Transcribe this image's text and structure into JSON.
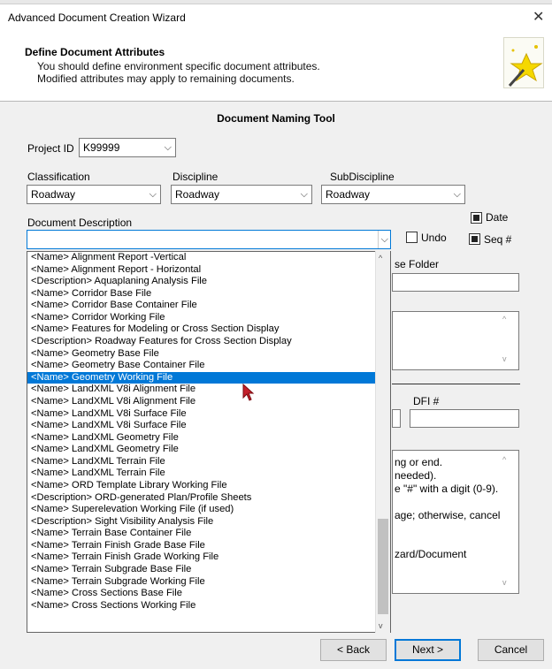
{
  "window": {
    "title": "Advanced Document Creation Wizard"
  },
  "header": {
    "title": "Define Document Attributes",
    "line1": "You should define environment specific document attributes.",
    "line2": "Modified attributes may apply to remaining documents."
  },
  "tool": {
    "title": "Document Naming Tool"
  },
  "project": {
    "label": "Project ID",
    "value": "K99999"
  },
  "classification": {
    "label": "Classification",
    "value": "Roadway"
  },
  "discipline": {
    "label": "Discipline",
    "value": "Roadway"
  },
  "subdiscipline": {
    "label": "SubDiscipline",
    "value": "Roadway"
  },
  "description": {
    "label": "Document Description",
    "value": ""
  },
  "options": {
    "date_label": "Date",
    "date_checked": true,
    "seq_label": "Seq #",
    "seq_checked": true,
    "undo_label": "Undo",
    "undo_checked": false
  },
  "folder": {
    "label_partial": "se Folder"
  },
  "dfi": {
    "label": "DFI #"
  },
  "help_partial": {
    "l1": "ng or end.",
    "l2": "needed).",
    "l3": "e \"#\" with a digit (0-9).",
    "l4": "age; otherwise, cancel",
    "l5": "zard/Document"
  },
  "dropdown": {
    "selected_index": 11,
    "items": [
      "<Name> Alignment Report -Vertical",
      "<Name> Alignment Report - Horizontal",
      "<Description> Aquaplaning Analysis File",
      "<Name> Corridor Base File",
      "<Name> Corridor Base Container File",
      "<Name> Corridor Working File",
      "<Name> Features for Modeling or Cross Section Display",
      "<Description> Roadway Features for Cross Section Display",
      "<Name> Geometry Base File",
      "<Name> Geometry Base Container File",
      "<Name> Geometry Working File",
      "<Name> LandXML V8i Alignment File",
      "<Name> LandXML V8i Alignment File",
      "<Name> LandXML V8i Surface File",
      "<Name> LandXML V8i Surface File",
      "<Name> LandXML Geometry File",
      "<Name> LandXML Geometry File",
      "<Name> LandXML Terrain File",
      "<Name> LandXML Terrain File",
      "<Name> ORD Template Library Working File",
      "<Description> ORD-generated Plan/Profile Sheets",
      "<Name> Superelevation Working File (if used)",
      "<Description> Sight Visibility Analysis File",
      "<Name> Terrain Base Container File",
      "<Name> Terrain Finish Grade Base File",
      "<Name> Terrain Finish Grade Working File",
      "<Name> Terrain Subgrade Base File",
      "<Name> Terrain Subgrade Working File",
      "<Name> Cross Sections Base File",
      "<Name> Cross Sections Working File"
    ]
  },
  "buttons": {
    "back": "< Back",
    "next": "Next >",
    "cancel": "Cancel"
  }
}
